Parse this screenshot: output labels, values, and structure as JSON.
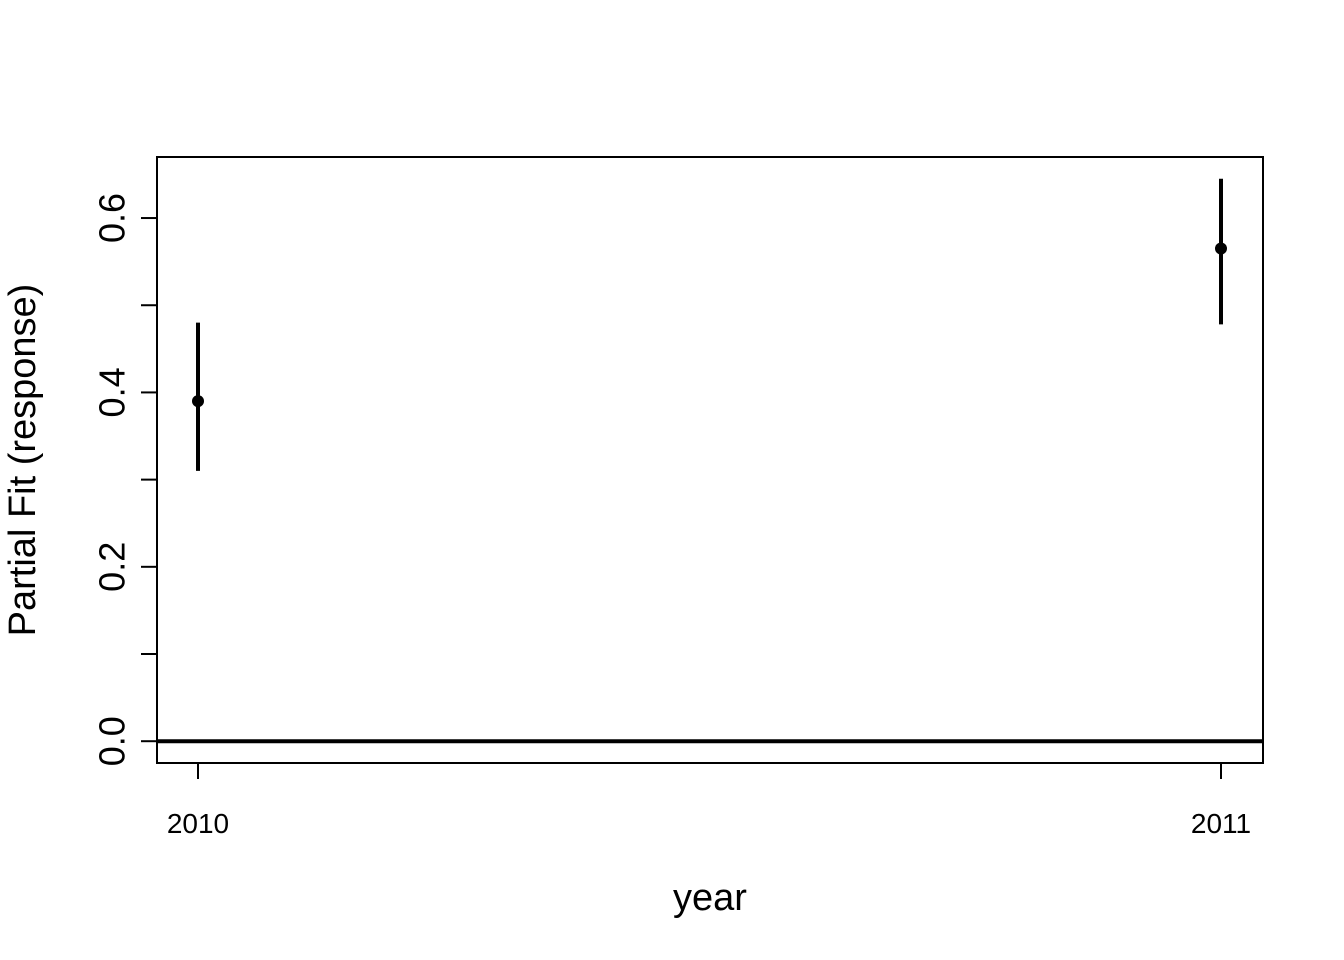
{
  "chart_data": {
    "type": "scatter",
    "title": "",
    "xlabel": "year",
    "ylabel": "Partial Fit (response)",
    "categories": [
      "2010",
      "2011"
    ],
    "series": [
      {
        "values": [
          0.39,
          0.565
        ],
        "lower": [
          0.31,
          0.478
        ],
        "upper": [
          0.48,
          0.645
        ]
      }
    ],
    "reference_line": 0.0,
    "ylim": [
      -0.025,
      0.67
    ],
    "yticks": [
      0.0,
      0.1,
      0.2,
      0.3,
      0.4,
      0.5,
      0.6
    ],
    "ytick_labels": [
      "0.0",
      "",
      "0.2",
      "",
      "0.4",
      "",
      "0.6"
    ],
    "grid": false,
    "legend": "none",
    "colors": {
      "points": "#000000",
      "reference_line": "#000000"
    }
  }
}
